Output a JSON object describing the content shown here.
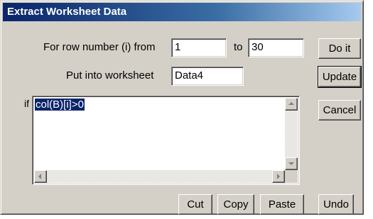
{
  "window": {
    "title": "Extract Worksheet Data"
  },
  "form": {
    "row_from_label": "For row number (i) from",
    "row_from_value": "1",
    "row_to_label": "to",
    "row_to_value": "30",
    "worksheet_label": "Put into worksheet",
    "worksheet_value": "Data4",
    "condition_label": "if",
    "condition_value": "col(B)[i]>0"
  },
  "buttons": {
    "do_it": "Do it",
    "update": "Update",
    "cancel": "Cancel",
    "cut": "Cut",
    "copy": "Copy",
    "paste": "Paste",
    "undo": "Undo"
  },
  "icons": {
    "scroll_up": "scroll-up-arrow",
    "scroll_down": "scroll-down-arrow",
    "scroll_left": "scroll-left-arrow",
    "scroll_right": "scroll-right-arrow"
  },
  "colors": {
    "title_gradient_start": "#0a246a",
    "title_gradient_end": "#a6caf0",
    "dialog_bg": "#d4d0c8",
    "selection_bg": "#0a246a"
  }
}
